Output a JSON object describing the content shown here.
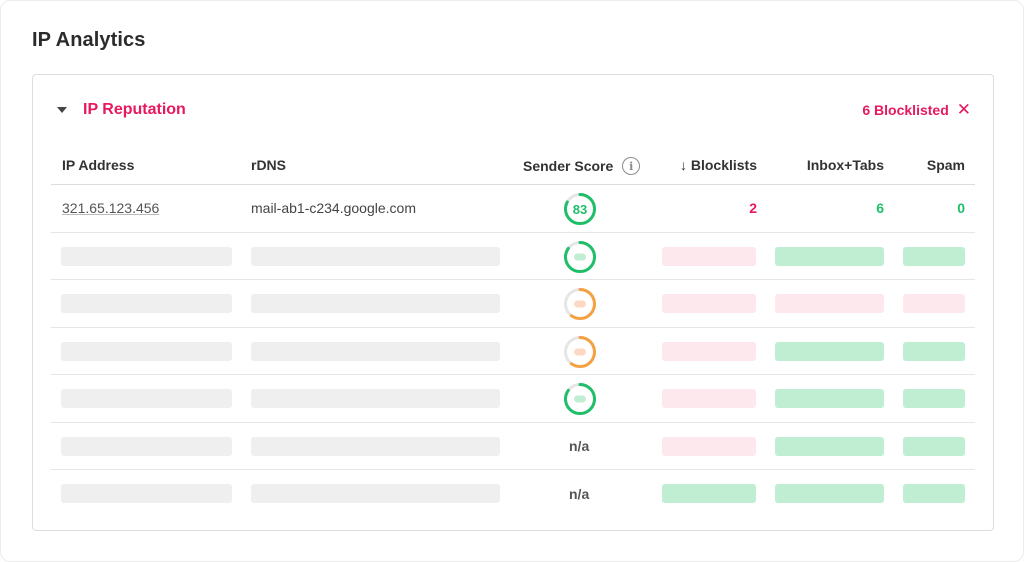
{
  "page": {
    "title": "IP Analytics"
  },
  "section": {
    "title": "IP Reputation",
    "blocklisted_label": "6 Blocklisted",
    "close_glyph": "✕",
    "collapse_icon": "caret-down-icon"
  },
  "table": {
    "headers": {
      "ip": "IP Address",
      "rdns": "rDNS",
      "sender_score": "Sender Score",
      "blocklists": "↓ Blocklists",
      "inbox": "Inbox+Tabs",
      "spam": "Spam"
    },
    "info_glyph": "i",
    "first_row": {
      "ip": "321.65.123.456",
      "rdns": "mail-ab1-c234.google.com",
      "score": "83",
      "score_level": 0.83,
      "blocklists": "2",
      "inbox": "6",
      "spam": "0"
    },
    "placeholder_rows": [
      {
        "score_status": "good",
        "score_level": 0.85,
        "blocklists": "pink",
        "inbox": "green",
        "spam": "green"
      },
      {
        "score_status": "warning",
        "score_level": 0.6,
        "blocklists": "pink",
        "inbox": "pink",
        "spam": "pink"
      },
      {
        "score_status": "warning",
        "score_level": 0.6,
        "blocklists": "pink",
        "inbox": "green",
        "spam": "green"
      },
      {
        "score_status": "good",
        "score_level": 0.85,
        "blocklists": "pink",
        "inbox": "green",
        "spam": "green"
      },
      {
        "score_status": "na",
        "score_text": "n/a",
        "blocklists": "pink",
        "inbox": "green",
        "spam": "green"
      },
      {
        "score_status": "na",
        "score_text": "n/a",
        "blocklists": "green",
        "inbox": "green",
        "spam": "green"
      }
    ]
  },
  "colors": {
    "accent_pink": "#e8185f",
    "good_green": "#1fbf6a",
    "warning_orange": "#f5a041",
    "pink_fill": "#fde8ee",
    "green_fill": "#bfeed2"
  }
}
